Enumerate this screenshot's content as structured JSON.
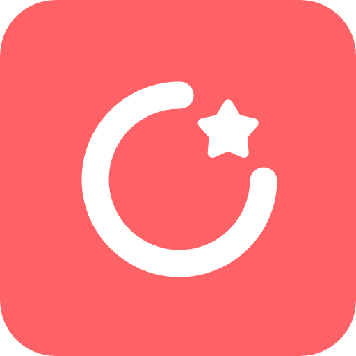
{
  "app_icon": {
    "icon_name": "arc-star-logo-icon",
    "background_color": "#FF6266",
    "glyph_color": "#FFFFFF"
  }
}
